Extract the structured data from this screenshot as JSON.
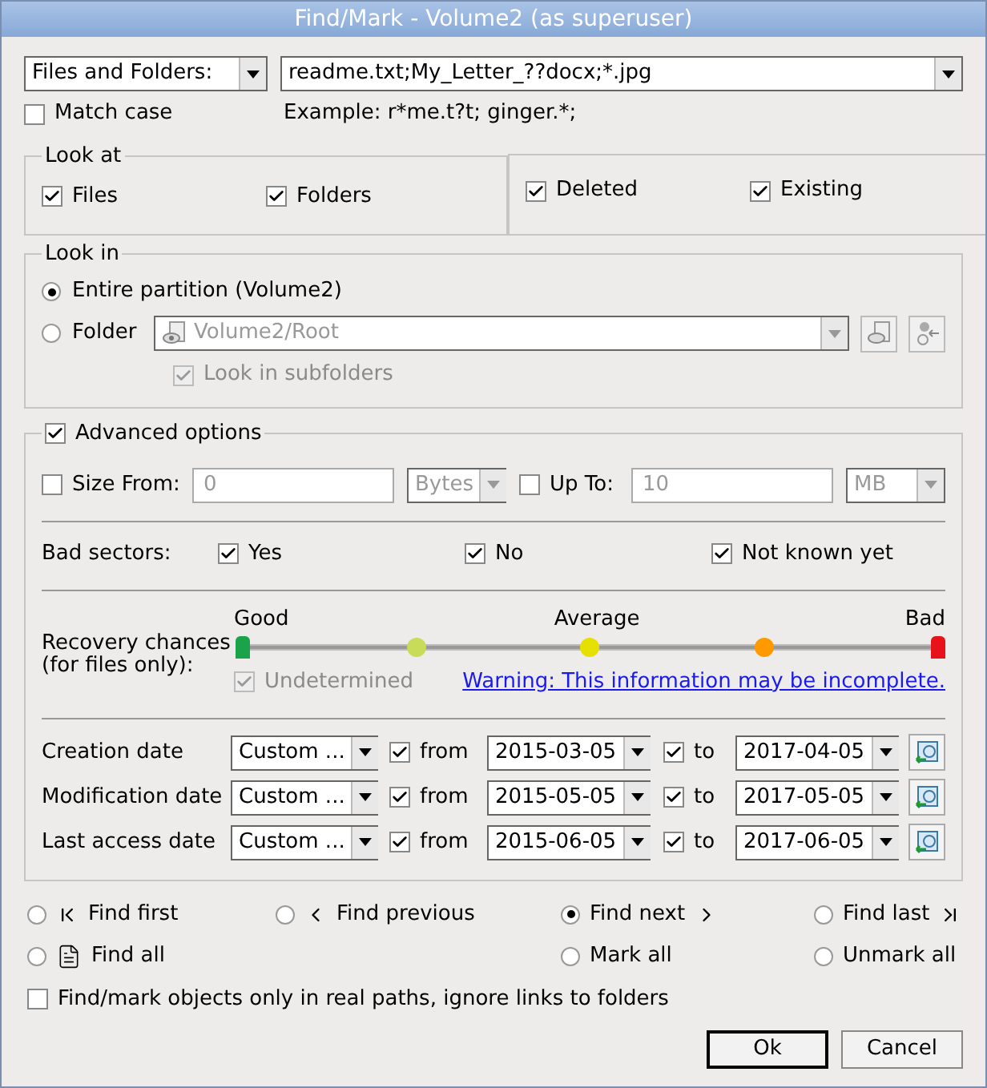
{
  "window": {
    "title": "Find/Mark - Volume2 (as superuser)"
  },
  "search": {
    "type": "Files and Folders:",
    "value": "readme.txt;My_Letter_??docx;*.jpg",
    "match_case": {
      "label": "Match case",
      "checked": false
    },
    "example": "Example: r*me.t?t; ginger.*;"
  },
  "look_at": {
    "title": "Look at",
    "options": [
      {
        "label": "Files",
        "checked": true
      },
      {
        "label": "Folders",
        "checked": true
      }
    ],
    "states": [
      {
        "label": "Deleted",
        "checked": true
      },
      {
        "label": "Existing",
        "checked": true
      }
    ]
  },
  "look_in": {
    "title": "Look in",
    "options": [
      {
        "label": "Entire partition (Volume2)",
        "selected": true
      },
      {
        "label": "Folder",
        "selected": false
      }
    ],
    "folder": "Volume2/Root",
    "subfolders": {
      "label": "Look in subfolders",
      "checked": true,
      "disabled": true
    }
  },
  "advanced": {
    "label": "Advanced options",
    "checked": true,
    "size_from": {
      "label": "Size From:",
      "checked": false,
      "disabled": true,
      "value": "0",
      "unit": "Bytes"
    },
    "size_to": {
      "label": "Up To:",
      "checked": false,
      "disabled": true,
      "value": "10",
      "unit": "MB"
    },
    "bad_sectors": {
      "label": "Bad sectors:",
      "options": [
        {
          "label": "Yes",
          "checked": true
        },
        {
          "label": "No",
          "checked": true
        },
        {
          "label": "Not known yet",
          "checked": true
        }
      ]
    },
    "recovery": {
      "label": "Recovery chances\n(for files only):",
      "scale": [
        "Good",
        "Average",
        "Bad"
      ],
      "thumbs": [
        {
          "level": 0,
          "color": "#1aa34a"
        },
        {
          "level": 1,
          "color": "#e8121a"
        }
      ],
      "stops": [
        {
          "color": "#c8dc5a"
        },
        {
          "color": "#e6e000"
        },
        {
          "color": "#ff9900"
        }
      ],
      "undetermined": {
        "label": "Undetermined",
        "checked": true,
        "disabled": true
      },
      "warning": "Warning: This information may be incomplete."
    },
    "dates": [
      {
        "label": "Creation date",
        "preset": "Custom ...",
        "from_checked": true,
        "from_label": "from",
        "from": "2015-03-05",
        "to_checked": true,
        "to_label": "to",
        "to": "2017-04-05"
      },
      {
        "label": "Modification date",
        "preset": "Custom ...",
        "from_checked": true,
        "from_label": "from",
        "from": "2015-05-05",
        "to_checked": true,
        "to_label": "to",
        "to": "2017-05-05"
      },
      {
        "label": "Last access date",
        "preset": "Custom ...",
        "from_checked": true,
        "from_label": "from",
        "from": "2015-06-05",
        "to_checked": true,
        "to_label": "to",
        "to": "2017-06-05"
      }
    ]
  },
  "actions": [
    {
      "label": "Find first",
      "kind": "first",
      "selected": false
    },
    {
      "label": "Find previous",
      "kind": "previous",
      "selected": false
    },
    {
      "label": "Find next",
      "kind": "next",
      "selected": true
    },
    {
      "label": "Find last",
      "kind": "last",
      "selected": false
    },
    {
      "label": "Find all",
      "kind": "all",
      "selected": false
    },
    {
      "label": "Mark all",
      "kind": "mark",
      "selected": false
    },
    {
      "label": "Unmark all",
      "kind": "unmark",
      "selected": false
    }
  ],
  "real_paths": {
    "label": "Find/mark objects only in real paths, ignore links to folders",
    "checked": false
  },
  "buttons": [
    {
      "label": "Ok",
      "default": true
    },
    {
      "label": "Cancel",
      "default": false
    }
  ]
}
